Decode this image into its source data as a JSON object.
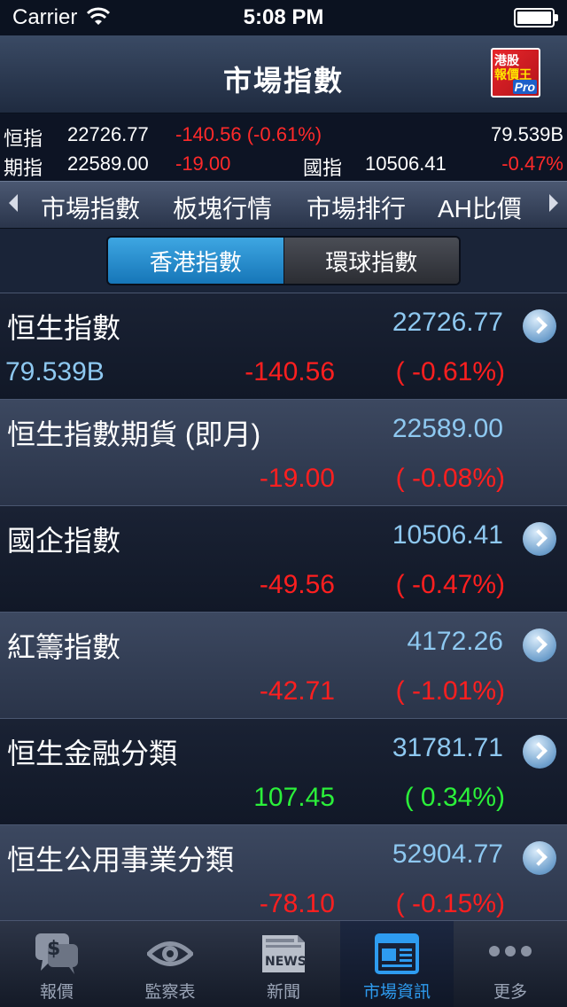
{
  "status_bar": {
    "carrier": "Carrier",
    "time": "5:08 PM"
  },
  "nav": {
    "title": "市場指數",
    "logo_line1": "港股",
    "logo_line2": "報價王",
    "logo_badge": "Pro"
  },
  "ticker": {
    "hsi_label": "恒指",
    "hsi_value": "22726.77",
    "hsi_change": "-140.56 (-0.61%)",
    "turnover": "79.539B",
    "fut_label": "期指",
    "fut_value": "22589.00",
    "fut_change": "-19.00",
    "hscei_label": "國指",
    "hscei_value": "10506.41",
    "hscei_pct": "-0.47%"
  },
  "tabs": [
    "市場指數",
    "板塊行情",
    "市場排行",
    "AH比價"
  ],
  "segments": {
    "left": "香港指數",
    "right": "環球指數"
  },
  "rows": [
    {
      "name": "恒生指數",
      "value": "22726.77",
      "turnover": "79.539B",
      "change": "-140.56",
      "pct": "( -0.61%)",
      "dir": "down",
      "chevron": true
    },
    {
      "name": "恒生指數期貨 (即月)",
      "value": "22589.00",
      "turnover": "",
      "change": "-19.00",
      "pct": "( -0.08%)",
      "dir": "down",
      "chevron": false
    },
    {
      "name": "國企指數",
      "value": "10506.41",
      "turnover": "",
      "change": "-49.56",
      "pct": "( -0.47%)",
      "dir": "down",
      "chevron": true
    },
    {
      "name": "紅籌指數",
      "value": "4172.26",
      "turnover": "",
      "change": "-42.71",
      "pct": "( -1.01%)",
      "dir": "down",
      "chevron": true
    },
    {
      "name": "恒生金融分類",
      "value": "31781.71",
      "turnover": "",
      "change": "107.45",
      "pct": "( 0.34%)",
      "dir": "up",
      "chevron": true
    },
    {
      "name": "恒生公用事業分類",
      "value": "52904.77",
      "turnover": "",
      "change": "-78.10",
      "pct": "( -0.15%)",
      "dir": "down",
      "chevron": true
    }
  ],
  "tab_bar": {
    "items": [
      "報價",
      "監察表",
      "新聞",
      "市場資訊",
      "更多"
    ],
    "news_icon_text": "NEWS",
    "active_index": 3
  },
  "colors": {
    "up": "#2bf03a",
    "down": "#ff1f1f",
    "value": "#8ec8f0",
    "accent": "#2e9cf0"
  }
}
